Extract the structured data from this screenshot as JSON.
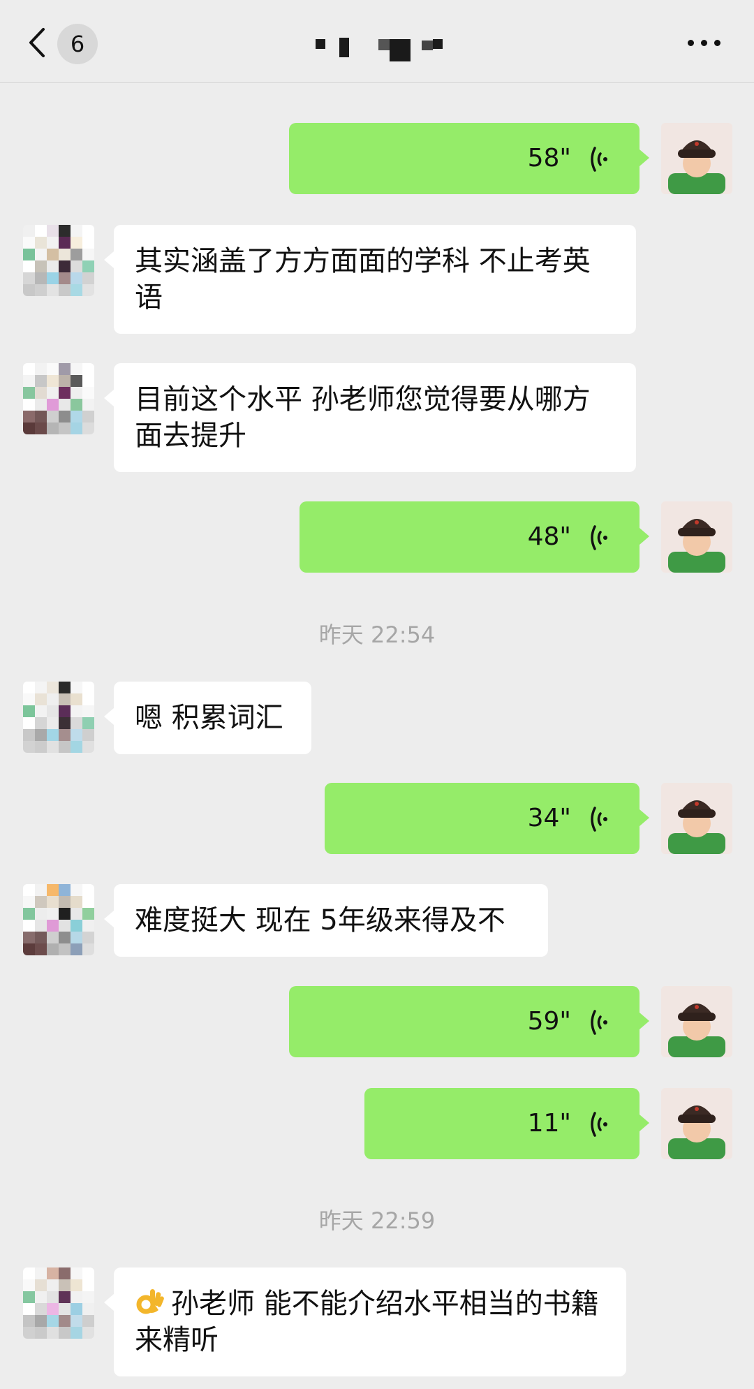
{
  "header": {
    "unread_count": "6",
    "title": ""
  },
  "timestamps": {
    "t1": "昨天 22:54",
    "t2": "昨天 22:59"
  },
  "messages": {
    "m1": {
      "duration": "58\""
    },
    "m2": {
      "text": "其实涵盖了方方面面的学科 不止考英语"
    },
    "m3": {
      "text": "目前这个水平 孙老师您觉得要从哪方面去提升"
    },
    "m4": {
      "duration": "48\""
    },
    "m5": {
      "text": "嗯 积累词汇"
    },
    "m6": {
      "duration": "34\""
    },
    "m7": {
      "text": "难度挺大 现在 5年级来得及不"
    },
    "m8": {
      "duration": "59\""
    },
    "m9": {
      "duration": "11\""
    },
    "m10": {
      "text": "孙老师 能不能介绍水平相当的书籍来精听",
      "emoji": "ok-hand-emoji"
    }
  },
  "colors": {
    "background": "#ededed",
    "voice_bubble": "#95ec69",
    "text_bubble": "#ffffff",
    "timestamp": "#a6a6a6"
  },
  "icons": [
    "back-chevron-icon",
    "more-dots-icon",
    "voice-wave-icon",
    "ok-hand-emoji"
  ]
}
